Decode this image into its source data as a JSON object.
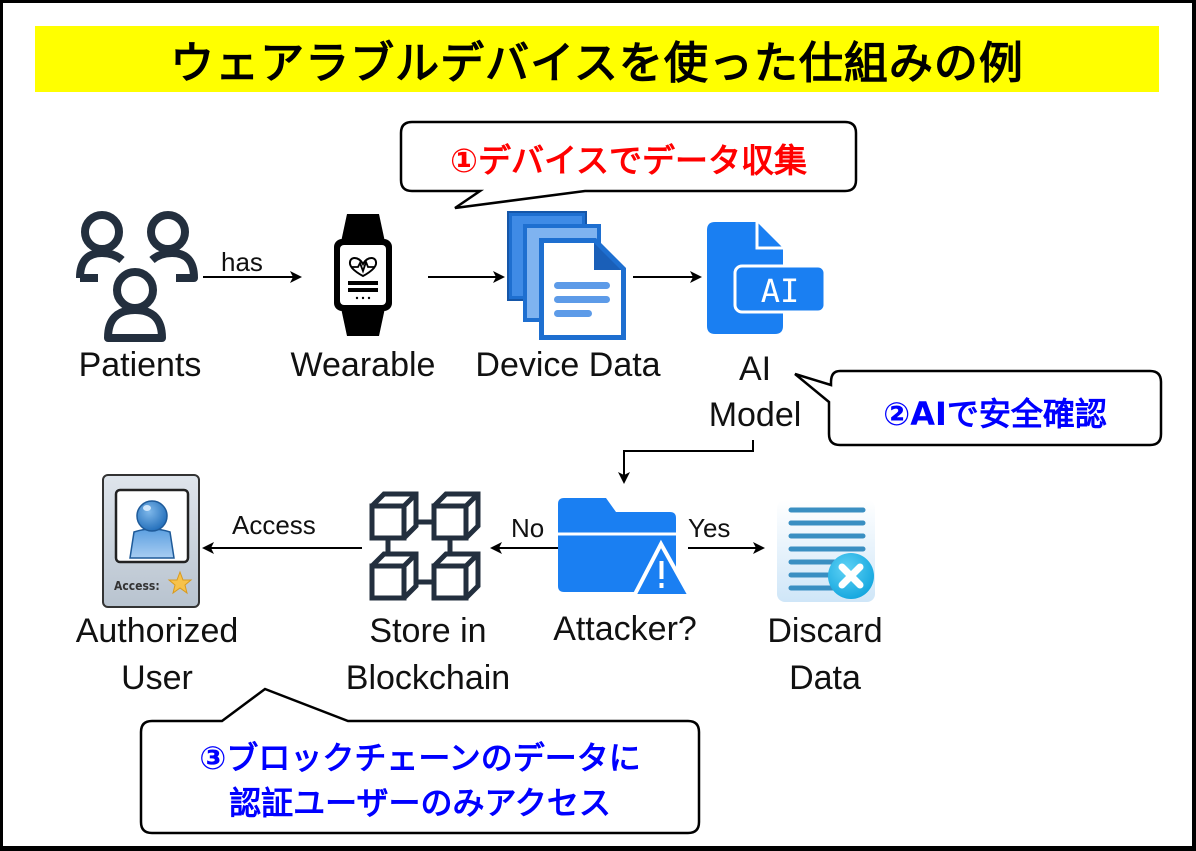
{
  "title": "ウェアラブルデバイスを使った仕組みの例",
  "callouts": [
    {
      "id": 1,
      "text": "①デバイスでデータ収集",
      "color": "#ff0000"
    },
    {
      "id": 2,
      "text": "②AIで安全確認",
      "color": "#0000ff"
    },
    {
      "id": 3,
      "line1": "③ブロックチェーンのデータに",
      "line2": "認証ユーザーのみアクセス",
      "color": "#0000ff"
    }
  ],
  "nodes": {
    "patients": "Patients",
    "wearable": "Wearable",
    "device_data": "Device Data",
    "ai_model_line1": "AI",
    "ai_model_line2": "Model",
    "attacker": "Attacker?",
    "discard_line1": "Discard",
    "discard_line2": "Data",
    "blockchain_line1": "Store in",
    "blockchain_line2": "Blockchain",
    "user_line1": "Authorized",
    "user_line2": "User"
  },
  "edges": {
    "has": "has",
    "no": "No",
    "yes": "Yes",
    "access": "Access"
  },
  "icons": {
    "patients": "people-group-icon",
    "wearable": "smartwatch-heart-icon",
    "device_data": "document-stack-icon",
    "ai_model": "ai-file-icon",
    "attacker": "folder-warning-icon",
    "discard": "document-delete-icon",
    "blockchain": "blockchain-cubes-icon",
    "user": "access-badge-icon",
    "badge_text": "Access:"
  },
  "colors": {
    "title_bg": "#ffff00",
    "icon_blue": "#1a7ff2",
    "icon_dark": "#232f3e"
  }
}
